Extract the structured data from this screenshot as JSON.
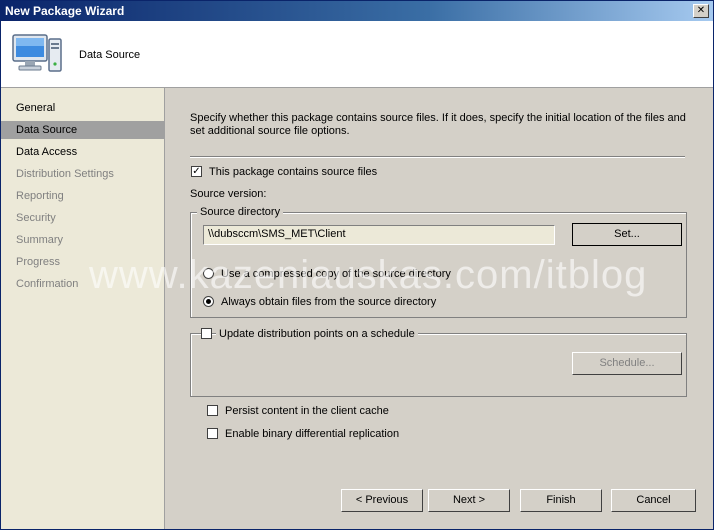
{
  "window": {
    "title": "New Package Wizard",
    "close_glyph": "✕"
  },
  "header": {
    "title": "Data Source",
    "icon": "computer-icon"
  },
  "sidebar": {
    "items": [
      {
        "label": "General",
        "state": "enabled"
      },
      {
        "label": "Data Source",
        "state": "selected"
      },
      {
        "label": "Data Access",
        "state": "enabled"
      },
      {
        "label": "Distribution Settings",
        "state": "disabled"
      },
      {
        "label": "Reporting",
        "state": "disabled"
      },
      {
        "label": "Security",
        "state": "disabled"
      },
      {
        "label": "Summary",
        "state": "disabled"
      },
      {
        "label": "Progress",
        "state": "disabled"
      },
      {
        "label": "Confirmation",
        "state": "disabled"
      }
    ]
  },
  "main": {
    "description": "Specify whether this package contains source files. If it does, specify the initial location of the files and set additional source file options.",
    "contains_source": {
      "label": "This package contains source files",
      "checked": true
    },
    "source_version_label": "Source version:",
    "source_directory": {
      "title": "Source directory",
      "value": "\\\\dubsccm\\SMS_MET\\Client",
      "set_button": "Set...",
      "option_compressed": "Use a compressed copy of the source directory",
      "option_always": "Always obtain files from the source directory",
      "selected_option": "always"
    },
    "schedule": {
      "checkbox_label": "Update distribution points on a schedule",
      "checked": false,
      "button": "Schedule..."
    },
    "persist": {
      "label": "Persist content in the client cache",
      "checked": false
    },
    "binary": {
      "label": "Enable binary differential replication",
      "checked": false
    }
  },
  "footer": {
    "previous": "< Previous",
    "next": "Next >",
    "finish": "Finish",
    "cancel": "Cancel"
  },
  "watermark": "www.kazeniauskas.com/itblog"
}
